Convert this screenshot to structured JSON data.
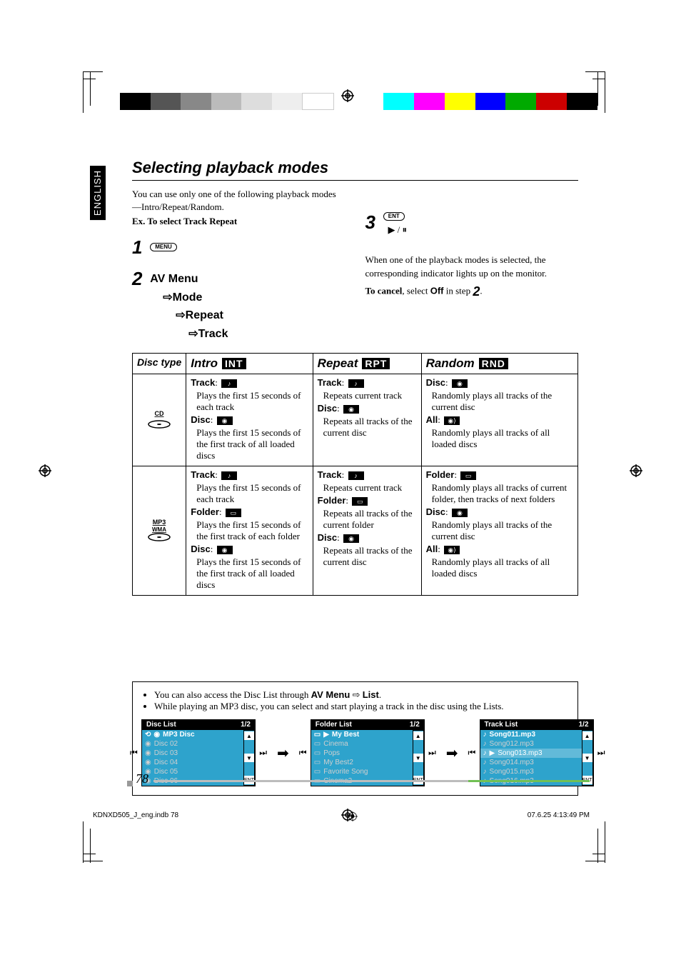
{
  "lang_tab": "ENGLISH",
  "section_title": "Selecting playback modes",
  "intro_para_1": "You can use only one of the following playback modes—Intro/Repeat/Random.",
  "intro_example_label": "Ex. To select Track Repeat",
  "step1_button": "MENU",
  "step2_path": {
    "a": "AV Menu",
    "b": "Mode",
    "c": "Repeat",
    "d": "Track"
  },
  "step3_button": "ENT",
  "step3_sub": "▶ / ⏸",
  "right_para_1": "When one of the playback modes is selected, the corresponding indicator lights up on the monitor.",
  "cancel_label": "To cancel",
  "cancel_rest": ", select ",
  "cancel_off": "Off",
  "cancel_in_step": " in step ",
  "cancel_step_num": "2",
  "table": {
    "col_disctype": "Disc type",
    "col_intro": "Intro",
    "col_intro_ind": "INT",
    "col_repeat": "Repeat",
    "col_repeat_ind": "RPT",
    "col_random": "Random",
    "col_random_ind": "RND",
    "row_cd": {
      "label": "CD",
      "intro": {
        "k1": "Track",
        "d1": "Plays the first 15 seconds of each track",
        "k2": "Disc",
        "d2": "Plays the first 15 seconds of the first track of all loaded discs"
      },
      "repeat": {
        "k1": "Track",
        "d1": "Repeats current track",
        "k2": "Disc",
        "d2": "Repeats all tracks of the current disc"
      },
      "random": {
        "k1": "Disc",
        "d1": "Randomly plays all tracks of the current disc",
        "k2": "All",
        "d2": "Randomly plays all tracks of all loaded discs"
      }
    },
    "row_mp3": {
      "labelA": "MP3",
      "labelB": "WMA",
      "intro": {
        "k1": "Track",
        "d1": "Plays the first 15 seconds of each track",
        "k2": "Folder",
        "d2": "Plays the first 15 seconds of the first track of each folder",
        "k3": "Disc",
        "d3": "Plays the first 15 seconds of the first track of all loaded discs"
      },
      "repeat": {
        "k1": "Track",
        "d1": "Repeats current track",
        "k2": "Folder",
        "d2": "Repeats all tracks of the current folder",
        "k3": "Disc",
        "d3": "Repeats all tracks of the current disc"
      },
      "random": {
        "k1": "Folder",
        "d1": "Randomly plays all tracks of current folder, then tracks of next folders",
        "k2": "Disc",
        "d2": "Randomly plays all tracks of the current disc",
        "k3": "All",
        "d3": "Randomly plays all tracks of all loaded discs"
      }
    }
  },
  "note_l1a": "You can also access the Disc List through ",
  "note_l1b": "AV Menu",
  "note_l1_arrow": " ⇨ ",
  "note_l1c": "List",
  "note_l2": "While playing an MP3 disc, you can select and start playing a track in the disc using the Lists.",
  "list_page": "1/2",
  "disc_list": {
    "title": "Disc List",
    "items": [
      "MP3 Disc",
      "Disc 02",
      "Disc 03",
      "Disc 04",
      "Disc 05",
      "Disc 06"
    ]
  },
  "folder_list": {
    "title": "Folder List",
    "items": [
      "My Best",
      "Cinema",
      "Pops",
      "My Best2",
      "Favorite Song",
      "Cinema2"
    ]
  },
  "track_list": {
    "title": "Track List",
    "items": [
      "Song011.mp3",
      "Song012.mp3",
      "Song013.mp3",
      "Song014.mp3",
      "Song015.mp3",
      "Song016.mp3"
    ]
  },
  "scroll_ent": "ENT",
  "page_number": "78",
  "footer_left": "KDNXD505_J_eng.indb   78",
  "footer_right": "07.6.25   4:13:49 PM"
}
